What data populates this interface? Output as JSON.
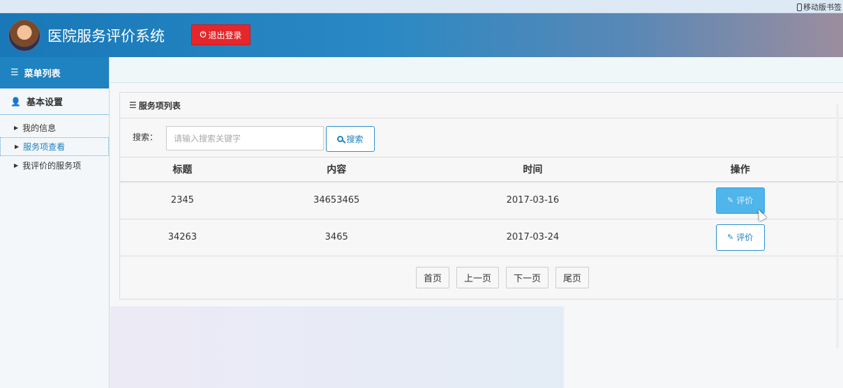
{
  "topbar": {
    "mobile_link": "移动版书签"
  },
  "header": {
    "app_title": "医院服务评价系统",
    "logout_label": "退出登录"
  },
  "sidebar": {
    "menu_title": "菜单列表",
    "section_title": "基本设置",
    "items": [
      {
        "label": "我的信息",
        "active": false
      },
      {
        "label": "服务项查看",
        "active": true
      },
      {
        "label": "我评价的服务项",
        "active": false
      }
    ]
  },
  "panel": {
    "title": "服务项列表",
    "search_label": "搜索：",
    "search_placeholder": "请输入搜索关键字",
    "search_value": "",
    "search_button": "搜索",
    "columns": [
      "标题",
      "内容",
      "时间",
      "操作"
    ],
    "rows": [
      {
        "title": "2345",
        "content": "34653465",
        "time": "2017-03-16",
        "action": "评价"
      },
      {
        "title": "34263",
        "content": "3465",
        "time": "2017-03-24",
        "action": "评价"
      }
    ],
    "pager": {
      "first": "首页",
      "prev": "上一页",
      "next": "下一页",
      "last": "尾页"
    }
  },
  "colors": {
    "header_blue": "#1f82c1",
    "logout_red": "#e5262b",
    "accent": "#2a8fcf"
  }
}
